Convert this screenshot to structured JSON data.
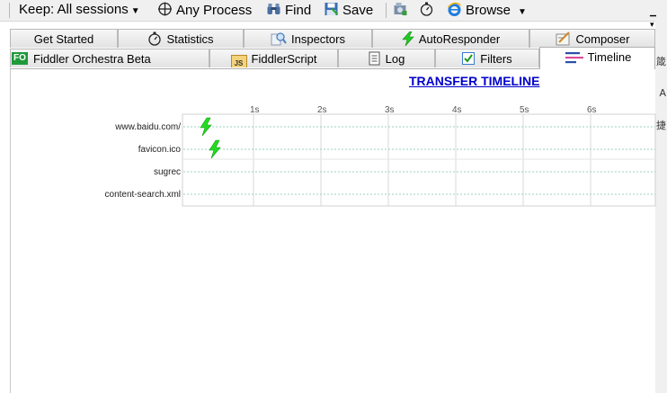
{
  "toolbar": {
    "keep_label": "Keep: All sessions",
    "any_process_label": "Any Process",
    "find_label": "Find",
    "save_label": "Save",
    "browse_label": "Browse"
  },
  "tabs": {
    "row1": [
      {
        "label": "Get Started",
        "icon": ""
      },
      {
        "label": "Statistics",
        "icon": "stopwatch-icon"
      },
      {
        "label": "Inspectors",
        "icon": "inspector-icon"
      },
      {
        "label": "AutoResponder",
        "icon": "lightning-icon"
      },
      {
        "label": "Composer",
        "icon": "composer-icon"
      }
    ],
    "row2": [
      {
        "label": "Fiddler Orchestra Beta",
        "icon": "fo-icon",
        "icon_text": "FO"
      },
      {
        "label": "FiddlerScript",
        "icon": "script-icon",
        "icon_text": "JS"
      },
      {
        "label": "Log",
        "icon": "log-icon"
      },
      {
        "label": "Filters",
        "icon": "checkbox-icon"
      },
      {
        "label": "Timeline",
        "icon": "timeline-icon",
        "active": true
      }
    ]
  },
  "timeline": {
    "title": "TRANSFER TIMELINE",
    "ticks": [
      "1s",
      "2s",
      "3s",
      "4s",
      "5s",
      "6s"
    ],
    "rows": [
      {
        "label": "www.baidu.com/",
        "bolt": true
      },
      {
        "label": "favicon.ico",
        "bolt": true
      },
      {
        "label": "sugrec",
        "bolt": false
      },
      {
        "label": "content-search.xml",
        "bolt": false
      }
    ]
  },
  "colors": {
    "accent": "#0000cc",
    "bolt": "#22dd22",
    "grid": "#d8d8d8",
    "dotted_row": "#9ad0c0"
  }
}
